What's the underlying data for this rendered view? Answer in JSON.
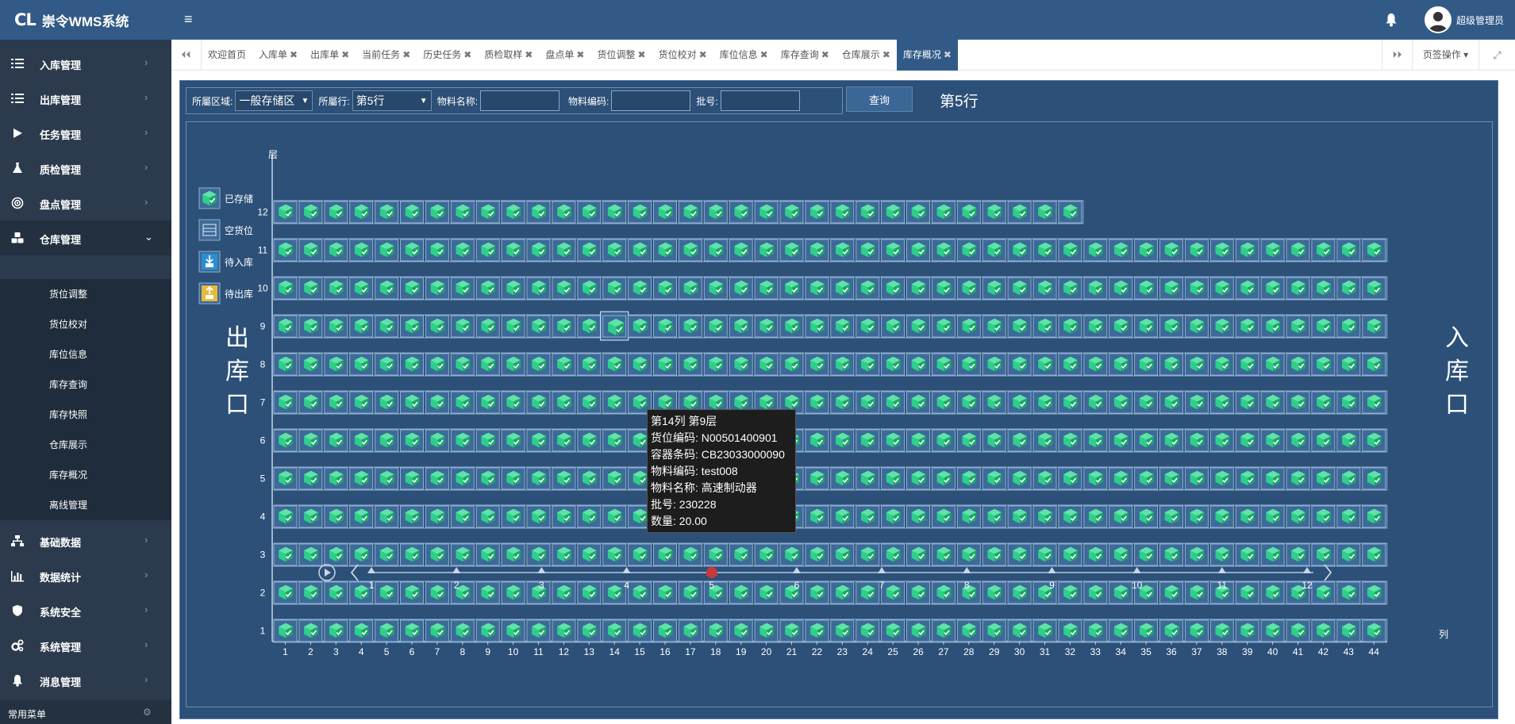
{
  "app": {
    "logo_mark": "CL",
    "title": "崇令WMS系统",
    "user": "超级管理员"
  },
  "sidebar": {
    "items": [
      {
        "label": "入库管理",
        "icon": "list-icon"
      },
      {
        "label": "出库管理",
        "icon": "list-icon"
      },
      {
        "label": "任务管理",
        "icon": "play-icon"
      },
      {
        "label": "质检管理",
        "icon": "flask-icon"
      },
      {
        "label": "盘点管理",
        "icon": "target-icon"
      },
      {
        "label": "仓库管理",
        "icon": "cubes-icon"
      },
      {
        "label": "基础数据",
        "icon": "sitemap-icon"
      },
      {
        "label": "数据统计",
        "icon": "bar-chart-icon"
      },
      {
        "label": "系统安全",
        "icon": "shield-icon"
      },
      {
        "label": "系统管理",
        "icon": "cogs-icon"
      },
      {
        "label": "消息管理",
        "icon": "bell-icon"
      }
    ],
    "submenu": [
      "货位调整",
      "货位校对",
      "库位信息",
      "库存查询",
      "库存快照",
      "仓库展示",
      "库存概况",
      "离线管理"
    ],
    "footer": "常用菜单"
  },
  "tabs": {
    "items": [
      "欢迎首页",
      "入库单",
      "出库单",
      "当前任务",
      "历史任务",
      "质检取样",
      "盘点单",
      "货位调整",
      "货位校对",
      "库位信息",
      "库存查询",
      "仓库展示",
      "库存概况"
    ],
    "active_index": 12,
    "ops_label": "页签操作"
  },
  "filters": {
    "area_label": "所屬区域:",
    "area_value": "一般存储区",
    "row_label": "所屬行:",
    "row_value": "第5行",
    "material_name_label": "物料名称:",
    "material_name_value": "",
    "material_code_label": "物料编码:",
    "material_code_value": "",
    "batch_label": "批号:",
    "batch_value": "",
    "query_button": "查询"
  },
  "view": {
    "row_title": "第5行",
    "layer_axis_label": "层",
    "column_axis_label": "列",
    "outbound_label": "出库口",
    "inbound_label": "入库口",
    "legend": [
      {
        "label": "已存储",
        "icon": "stored-box-icon"
      },
      {
        "label": "空货位",
        "icon": "empty-slot-icon"
      },
      {
        "label": "待入库",
        "icon": "pending-inbound-icon"
      },
      {
        "label": "待出库",
        "icon": "pending-outbound-icon"
      }
    ],
    "colors": {
      "stored": "#2ecf8a",
      "cell_border": "#8fb0d2",
      "panel": "#2c5078",
      "marker": "#c73a3a"
    }
  },
  "chart_data": {
    "type": "heatmap",
    "layers": [
      1,
      2,
      3,
      4,
      5,
      6,
      7,
      8,
      9,
      10,
      11,
      12
    ],
    "columns": [
      1,
      2,
      3,
      4,
      5,
      6,
      7,
      8,
      9,
      10,
      11,
      12,
      13,
      14,
      15,
      16,
      17,
      18,
      19,
      20,
      21,
      22,
      23,
      24,
      25,
      26,
      27,
      28,
      29,
      30,
      31,
      32,
      33,
      34,
      35,
      36,
      37,
      38,
      39,
      40,
      41,
      42,
      43,
      44
    ],
    "columns_per_layer": {
      "1": 44,
      "2": 44,
      "3": 44,
      "4": 44,
      "5": 44,
      "6": 44,
      "7": 44,
      "8": 44,
      "9": 44,
      "10": 44,
      "11": 44,
      "12": 32
    },
    "status": "已存储",
    "highlighted": {
      "column": 14,
      "layer": 9
    }
  },
  "tooltip": {
    "title": "第14列 第9层",
    "lines": [
      "货位编码: N00501400901",
      "容器条码: CB23033000090",
      "物料编码: test008",
      "物料名称: 高速制动器",
      "批号: 230228",
      "数量: 20.00"
    ]
  },
  "timeline": {
    "rows": [
      "1",
      "2",
      "3",
      "4",
      "5",
      "6",
      "7",
      "8",
      "9",
      "10",
      "11",
      "12"
    ],
    "current": 5
  }
}
